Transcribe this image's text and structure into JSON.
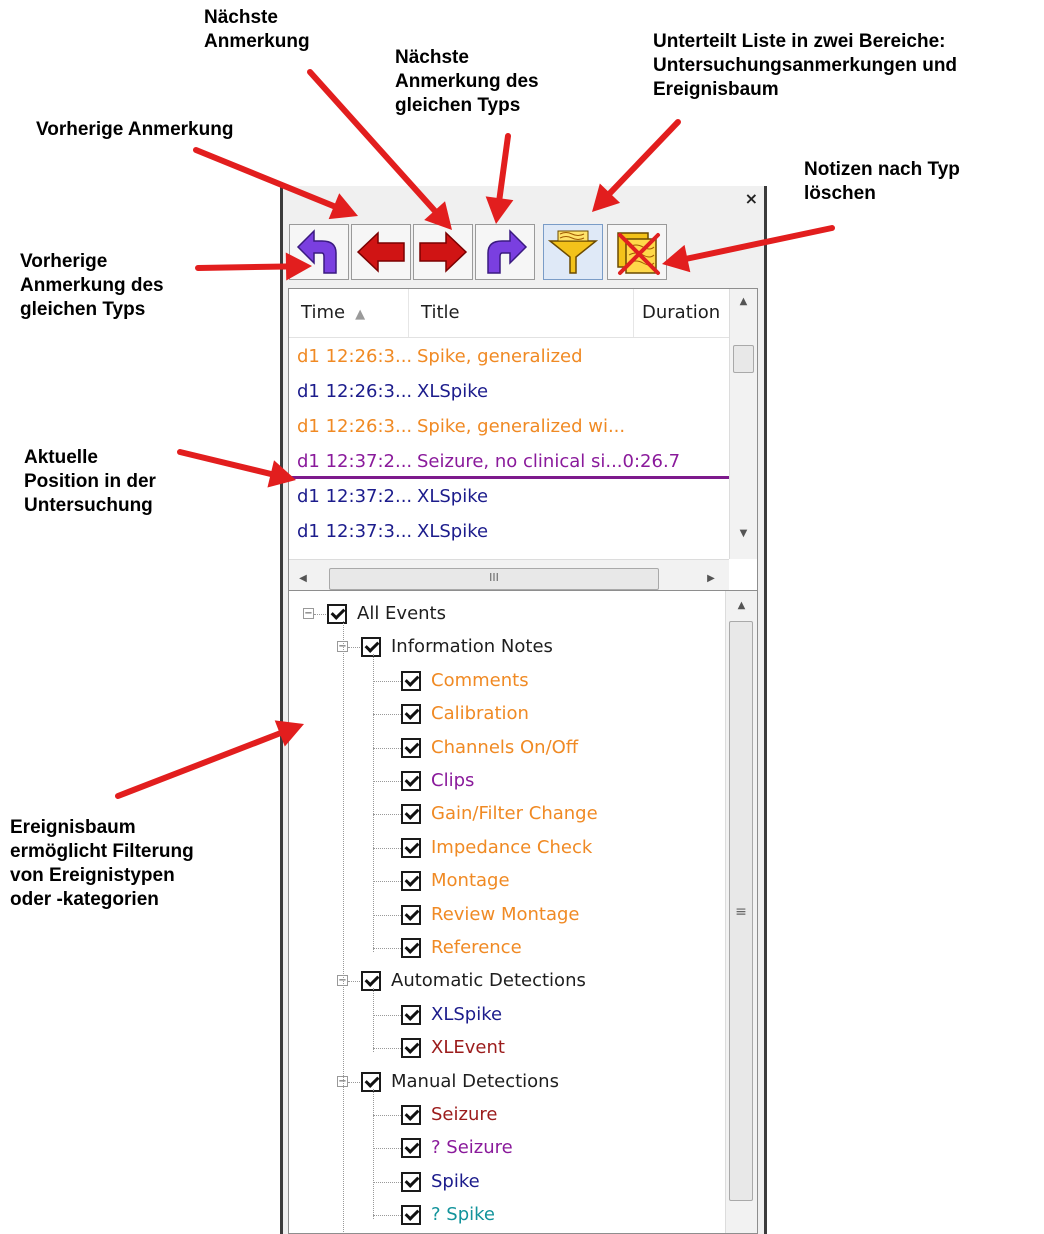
{
  "colors": {
    "orange": "#f08a24",
    "navy": "#1c1c8c",
    "purple": "#8a1a9b",
    "darkred": "#9b1b1b",
    "teal": "#12939b",
    "dark": "#1e1e1e",
    "arrow": "#e21e1e"
  },
  "callouts": {
    "naechste": "Nächste\nAnmerkung",
    "naechste_typ": "Nächste\nAnmerkung des\ngleichen Typs",
    "unterteilt": "Unterteilt Liste in zwei Bereiche:\nUntersuchungsanmerkungen und\nEreignisbaum",
    "vorherige": "Vorherige Anmerkung",
    "notizen": "Notizen nach Typ\nlöschen",
    "vorherige_typ": "Vorherige\nAnmerkung des\ngleichen Typs",
    "aktuelle": "Aktuelle\nPosition in der\nUntersuchung",
    "ereignisbaum": "Ereignisbaum\nermöglicht Filterung\nvon Ereignistypen\noder -kategorien"
  },
  "window": {
    "close_glyph": "×"
  },
  "toolbar": {
    "buttons": [
      {
        "icon": "prev-same-type-icon"
      },
      {
        "icon": "prev-annotation-icon"
      },
      {
        "icon": "next-annotation-icon"
      },
      {
        "icon": "next-same-type-icon"
      },
      {
        "icon": "split-list-icon"
      },
      {
        "icon": "delete-notes-icon"
      }
    ]
  },
  "list": {
    "columns": [
      "Time",
      "Title",
      "Duration"
    ],
    "sort_indicator": "▲",
    "rows": [
      {
        "time": "d1 12:26:3...",
        "title": "Spike, generalized",
        "duration": "",
        "color": "#f08a24"
      },
      {
        "time": "d1 12:26:3...",
        "title": "XLSpike",
        "duration": "",
        "color": "#1c1c8c"
      },
      {
        "time": "d1 12:26:3...",
        "title": "Spike, generalized wi...",
        "duration": "",
        "color": "#f08a24"
      },
      {
        "time": "d1 12:37:2...",
        "title": "Seizure, no clinical si...",
        "duration": "0:26.7",
        "color": "#8a1a9b",
        "current": true
      },
      {
        "time": "d1 12:37:2...",
        "title": "XLSpike",
        "duration": "",
        "color": "#1c1c8c"
      },
      {
        "time": "d1 12:37:3...",
        "title": "XLSpike",
        "duration": "",
        "color": "#1c1c8c"
      }
    ],
    "hscroll_grip": "III"
  },
  "tree": {
    "root": "All Events",
    "groups": [
      {
        "label": "Information Notes",
        "children": [
          {
            "label": "Comments",
            "color": "#f08a24"
          },
          {
            "label": "Calibration",
            "color": "#f08a24"
          },
          {
            "label": "Channels On/Off",
            "color": "#f08a24"
          },
          {
            "label": "Clips",
            "color": "#8a1a9b"
          },
          {
            "label": "Gain/Filter Change",
            "color": "#f08a24"
          },
          {
            "label": "Impedance Check",
            "color": "#f08a24"
          },
          {
            "label": "Montage",
            "color": "#f08a24"
          },
          {
            "label": "Review Montage",
            "color": "#f08a24"
          },
          {
            "label": "Reference",
            "color": "#f08a24"
          }
        ]
      },
      {
        "label": "Automatic Detections",
        "children": [
          {
            "label": "XLSpike",
            "color": "#1c1c8c"
          },
          {
            "label": "XLEvent",
            "color": "#9b1b1b"
          }
        ]
      },
      {
        "label": "Manual Detections",
        "children": [
          {
            "label": "Seizure",
            "color": "#9b1b1b"
          },
          {
            "label": "? Seizure",
            "color": "#8a1a9b"
          },
          {
            "label": "Spike",
            "color": "#1c1c8c"
          },
          {
            "label": "? Spike",
            "color": "#12939b"
          }
        ]
      }
    ],
    "scroll_grip": "≡"
  }
}
